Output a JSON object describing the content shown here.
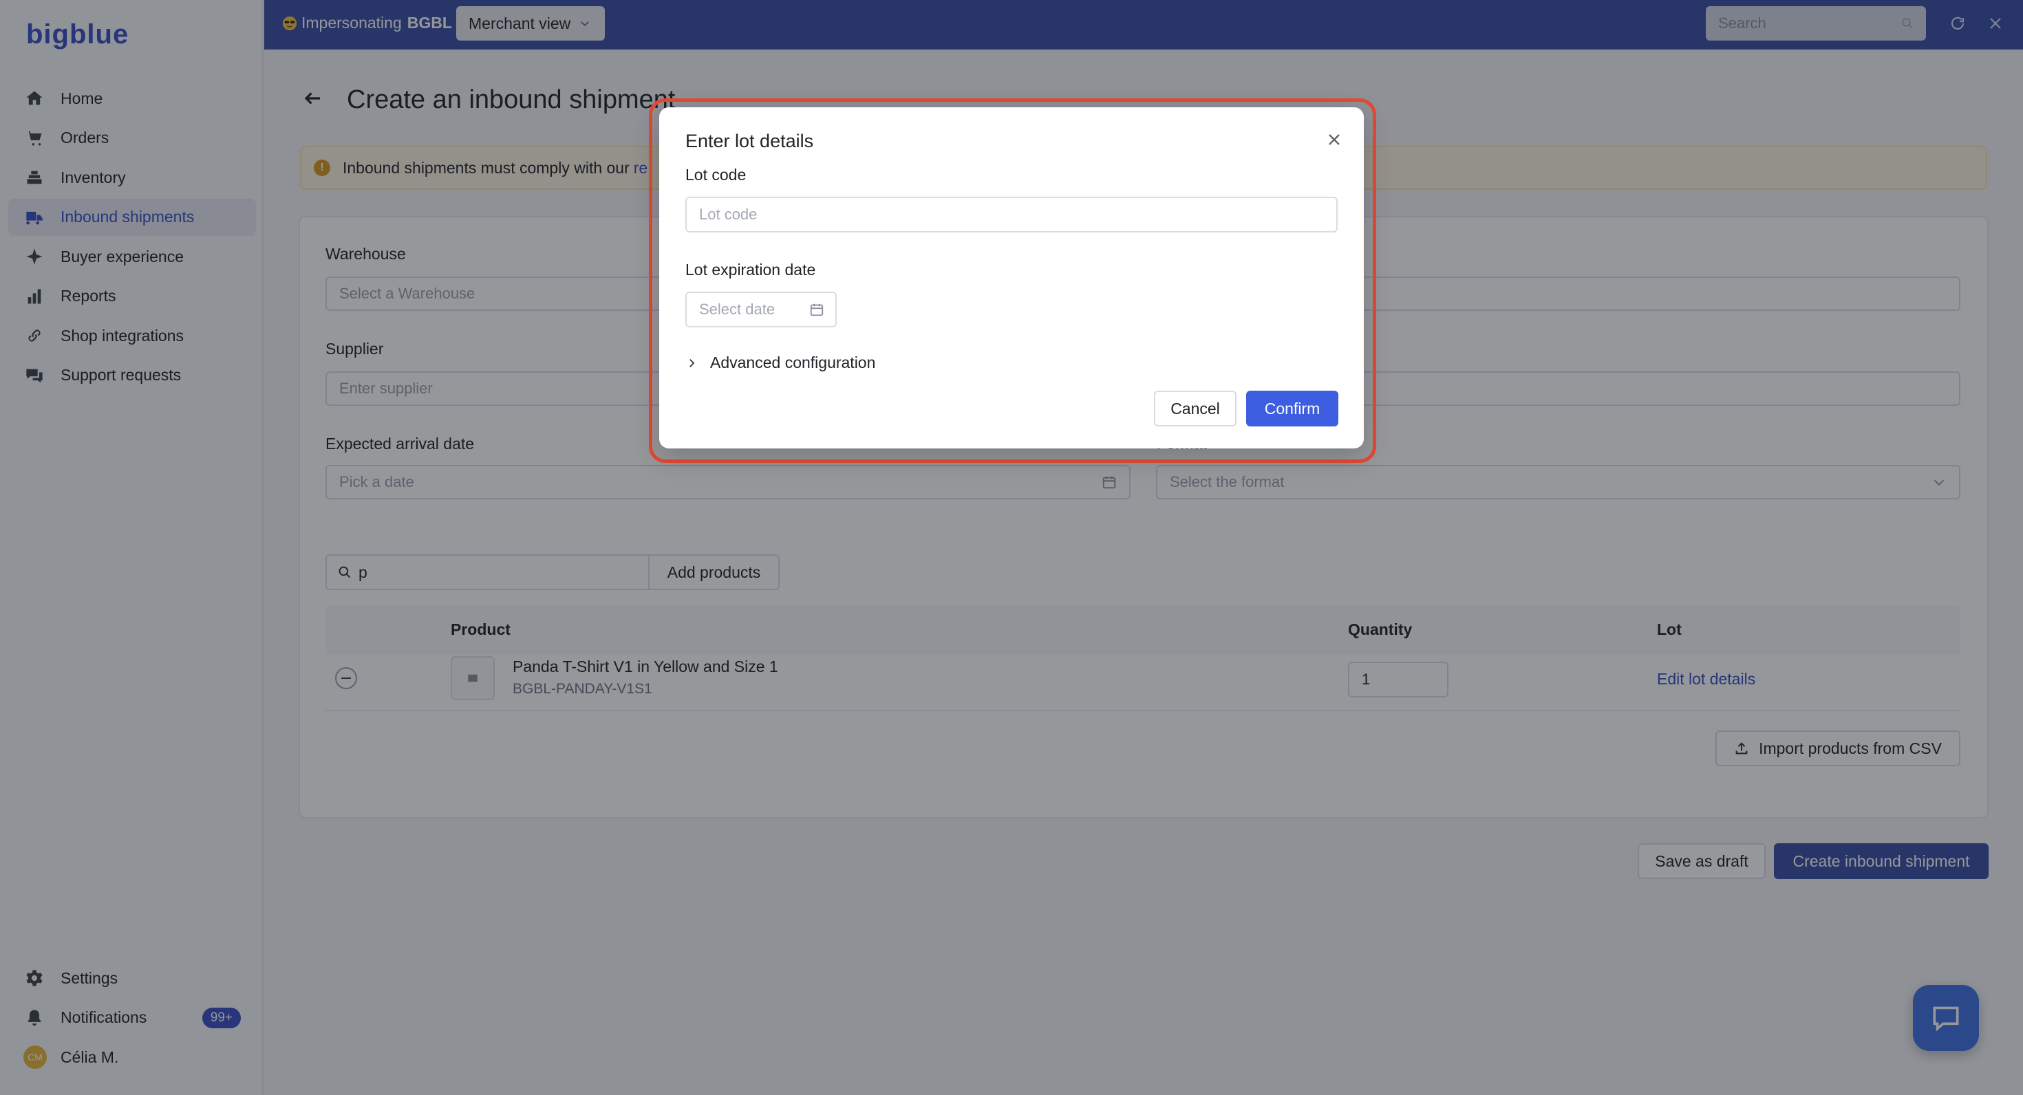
{
  "app": {
    "logo_text": "bigblue"
  },
  "topbar": {
    "impersonating_label": "Impersonating",
    "impersonating_merchant": "BGBL",
    "view_select": "Merchant view",
    "search_placeholder": "Search"
  },
  "sidebar": {
    "items": [
      {
        "label": "Home",
        "icon": "home-icon",
        "active": false
      },
      {
        "label": "Orders",
        "icon": "cart-icon",
        "active": false
      },
      {
        "label": "Inventory",
        "icon": "stack-icon",
        "active": false
      },
      {
        "label": "Inbound shipments",
        "icon": "truck-icon",
        "active": true
      },
      {
        "label": "Buyer experience",
        "icon": "sparkle-icon",
        "active": false
      },
      {
        "label": "Reports",
        "icon": "bar-chart-icon",
        "active": false
      },
      {
        "label": "Shop integrations",
        "icon": "link-icon",
        "active": false
      },
      {
        "label": "Support requests",
        "icon": "chat-icon",
        "active": false
      }
    ],
    "bottom": {
      "settings": "Settings",
      "notifications": "Notifications",
      "notifications_badge": "99+",
      "user_initials": "CM",
      "user_name": "Célia M."
    }
  },
  "page": {
    "title": "Create an inbound shipment",
    "banner_text": "Inbound shipments must comply with our",
    "banner_link": "re",
    "warehouse_label": "Warehouse",
    "warehouse_placeholder": "Select a Warehouse",
    "supplier_label": "Supplier",
    "supplier_placeholder": "Enter supplier",
    "arrival_label": "Expected arrival date",
    "arrival_placeholder": "Pick a date",
    "format_label": "Format",
    "format_placeholder": "Select the format",
    "search_value": "p",
    "add_products": "Add products",
    "table": {
      "headers": {
        "product": "Product",
        "quantity": "Quantity",
        "lot": "Lot"
      },
      "rows": [
        {
          "name": "Panda T-Shirt V1 in Yellow and Size 1",
          "sku": "BGBL-PANDAY-V1S1",
          "quantity": "1",
          "lot_action": "Edit lot details"
        }
      ]
    },
    "import_csv": "Import products from CSV",
    "save_draft": "Save as draft",
    "create_shipment": "Create inbound shipment"
  },
  "modal": {
    "title": "Enter lot details",
    "lot_code_label": "Lot code",
    "lot_code_placeholder": "Lot code",
    "expiration_label": "Lot expiration date",
    "expiration_placeholder": "Select date",
    "advanced": "Advanced configuration",
    "cancel": "Cancel",
    "confirm": "Confirm"
  },
  "colors": {
    "brand": "#3a4ea3",
    "accent": "#3d5ee0",
    "highlight": "#e24b33",
    "warning": "#d99a1d"
  }
}
